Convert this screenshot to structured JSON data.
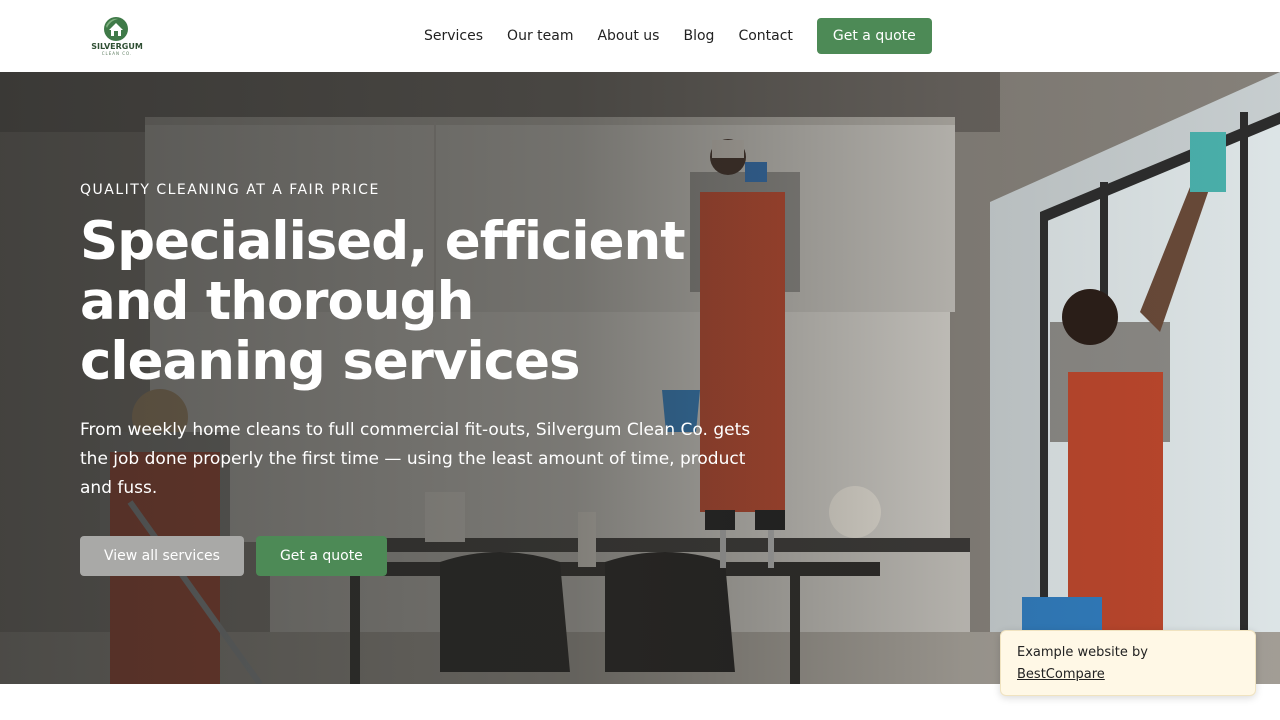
{
  "brand": {
    "name": "SILVERGUM",
    "tagline": "CLEAN CO."
  },
  "nav": {
    "items": [
      "Services",
      "Our team",
      "About us",
      "Blog",
      "Contact"
    ],
    "cta": "Get a quote"
  },
  "hero": {
    "eyebrow": "QUALITY CLEANING AT A FAIR PRICE",
    "headline": "Specialised, efficient and thorough cleaning services",
    "lede": "From weekly home cleans to full commercial fit-outs, Silvergum Clean Co. gets the job done properly the first time — using the least amount of time, product and fuss.",
    "secondary_button": "View all services",
    "primary_button": "Get a quote"
  },
  "toast": {
    "text": "Example website by",
    "link": "BestCompare"
  },
  "colors": {
    "accent": "#4d8a56",
    "secondary_button": "#a9a9a7",
    "toast_bg": "#fff8e6"
  }
}
